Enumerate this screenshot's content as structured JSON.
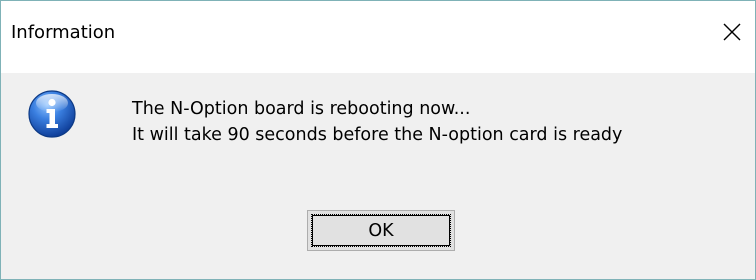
{
  "window": {
    "title": "Information",
    "close_icon": "close-icon"
  },
  "message": {
    "icon": "information-icon",
    "line1": "The N-Option board is rebooting now...",
    "line2": "It will take 90 seconds before the N-option card is ready"
  },
  "buttons": {
    "ok_label": "OK"
  },
  "colors": {
    "border": "#7fb2b7",
    "content_background": "#f0f0f0",
    "title_background": "#ffffff",
    "icon_blue": "#1f5fbf"
  }
}
